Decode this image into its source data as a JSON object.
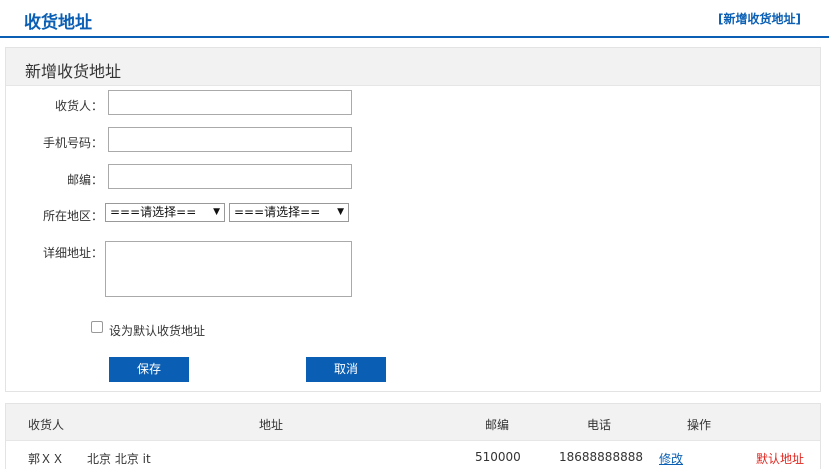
{
  "header": {
    "title": "收货地址",
    "add_link": "[新增收货地址]"
  },
  "form": {
    "title": "新增收货地址",
    "receiver_label": "收货人：",
    "receiver_value": "",
    "phone_label": "手机号码：",
    "phone_value": "",
    "zip_label": "邮编：",
    "zip_value": "",
    "region_label": "所在地区：",
    "province_selected": "===请选择==",
    "city_selected": "===请选择==",
    "address_label": "详细地址：",
    "default_checkbox_label": "设为默认收货地址",
    "default_checked": false,
    "save_label": "保存",
    "cancel_label": "取消"
  },
  "table": {
    "headers": {
      "receiver": "收货人",
      "address": "地址",
      "zip": "邮编",
      "phone": "电话",
      "actions": "操作"
    },
    "rows": [
      {
        "receiver": "郭ＸＸ",
        "address": "北京 北京 it",
        "zip": "510000",
        "phone": "18688888888",
        "edit": "修改",
        "set_default": "默认地址"
      }
    ]
  },
  "colors": {
    "accent": "#0a5fb4",
    "danger": "#e0261f"
  },
  "icons": {
    "select_caret": "chevron-down-icon"
  }
}
